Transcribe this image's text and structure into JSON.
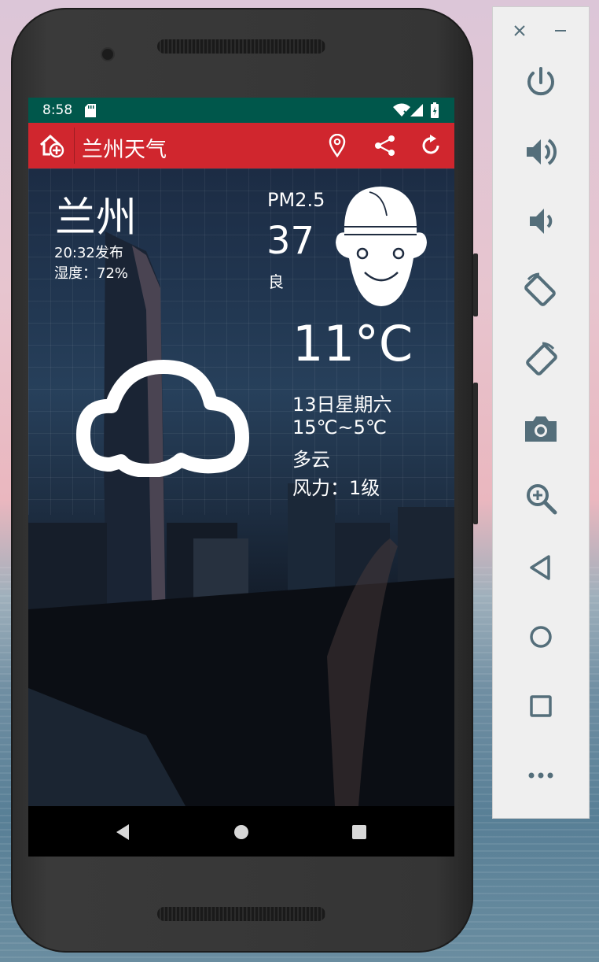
{
  "status_bar": {
    "time": "8:58"
  },
  "app_bar": {
    "title": "兰州天气"
  },
  "weather": {
    "city": "兰州",
    "publish_time": "20:32发布",
    "humidity": "湿度：72%",
    "pm25_label": "PM2.5",
    "pm25_value": "37",
    "air_quality": "良",
    "temperature": "11°C",
    "date": "13日星期六",
    "temp_range": "15℃~5℃",
    "condition": "多云",
    "wind": "风力：1级"
  },
  "emulator_toolbar": {
    "items": [
      "close-icon",
      "minimize-icon",
      "power-icon",
      "volume-up-icon",
      "volume-down-icon",
      "rotate-left-icon",
      "rotate-right-icon",
      "camera-icon",
      "zoom-icon",
      "back-icon",
      "home-icon",
      "overview-icon",
      "more-icon"
    ]
  },
  "colors": {
    "status_bar": "#00574b",
    "app_bar": "#d0262e",
    "toolbar_icon": "#546e7a"
  }
}
